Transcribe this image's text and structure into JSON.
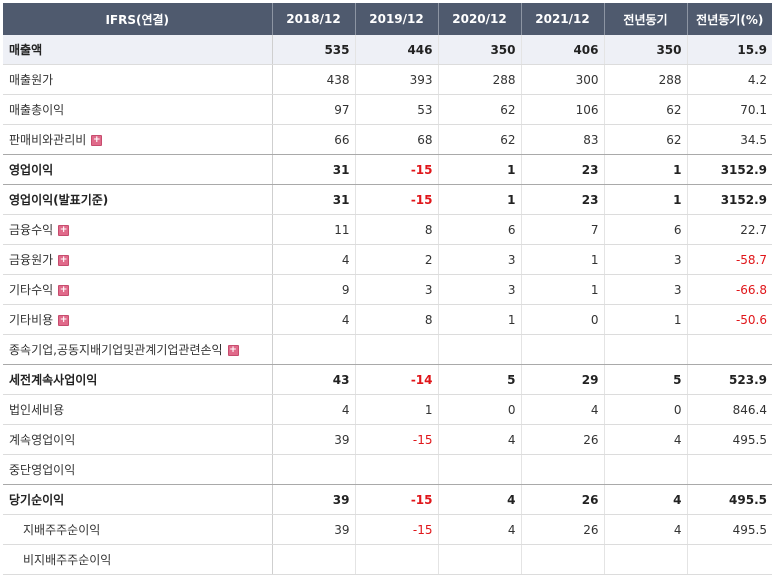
{
  "header": [
    "IFRS(연결)",
    "2018/12",
    "2019/12",
    "2020/12",
    "2021/12",
    "전년동기",
    "전년동기(%)"
  ],
  "rows": [
    {
      "label": "매출액",
      "values": [
        "535",
        "446",
        "350",
        "406",
        "350",
        "15.9"
      ],
      "bold": true,
      "hl": true
    },
    {
      "label": "매출원가",
      "values": [
        "438",
        "393",
        "288",
        "300",
        "288",
        "4.2"
      ]
    },
    {
      "label": "매출총이익",
      "values": [
        "97",
        "53",
        "62",
        "106",
        "62",
        "70.1"
      ]
    },
    {
      "label": "판매비와관리비",
      "values": [
        "66",
        "68",
        "62",
        "83",
        "62",
        "34.5"
      ],
      "expand": true,
      "sep": true
    },
    {
      "label": "영업이익",
      "values": [
        "31",
        "-15",
        "1",
        "23",
        "1",
        "3152.9"
      ],
      "bold": true,
      "sep": true
    },
    {
      "label": "영업이익(발표기준)",
      "values": [
        "31",
        "-15",
        "1",
        "23",
        "1",
        "3152.9"
      ],
      "bold": true
    },
    {
      "label": "금융수익",
      "values": [
        "11",
        "8",
        "6",
        "7",
        "6",
        "22.7"
      ],
      "expand": true
    },
    {
      "label": "금융원가",
      "values": [
        "4",
        "2",
        "3",
        "1",
        "3",
        "-58.7"
      ],
      "expand": true
    },
    {
      "label": "기타수익",
      "values": [
        "9",
        "3",
        "3",
        "1",
        "3",
        "-66.8"
      ],
      "expand": true
    },
    {
      "label": "기타비용",
      "values": [
        "4",
        "8",
        "1",
        "0",
        "1",
        "-50.6"
      ],
      "expand": true
    },
    {
      "label": "종속기업,공동지배기업및관계기업관련손익",
      "values": [
        "",
        "",
        "",
        "",
        "",
        ""
      ],
      "expand": true,
      "sep": true
    },
    {
      "label": "세전계속사업이익",
      "values": [
        "43",
        "-14",
        "5",
        "29",
        "5",
        "523.9"
      ],
      "bold": true
    },
    {
      "label": "법인세비용",
      "values": [
        "4",
        "1",
        "0",
        "4",
        "0",
        "846.4"
      ]
    },
    {
      "label": "계속영업이익",
      "values": [
        "39",
        "-15",
        "4",
        "26",
        "4",
        "495.5"
      ]
    },
    {
      "label": "중단영업이익",
      "values": [
        "",
        "",
        "",
        "",
        "",
        ""
      ],
      "sep": true
    },
    {
      "label": "당기순이익",
      "values": [
        "39",
        "-15",
        "4",
        "26",
        "4",
        "495.5"
      ],
      "bold": true
    },
    {
      "label": "지배주주순이익",
      "values": [
        "39",
        "-15",
        "4",
        "26",
        "4",
        "495.5"
      ],
      "indent": true
    },
    {
      "label": "비지배주주순이익",
      "values": [
        "",
        "",
        "",
        "",
        "",
        ""
      ],
      "indent": true
    }
  ],
  "icons": {
    "expand": "plus-expand-icon"
  }
}
